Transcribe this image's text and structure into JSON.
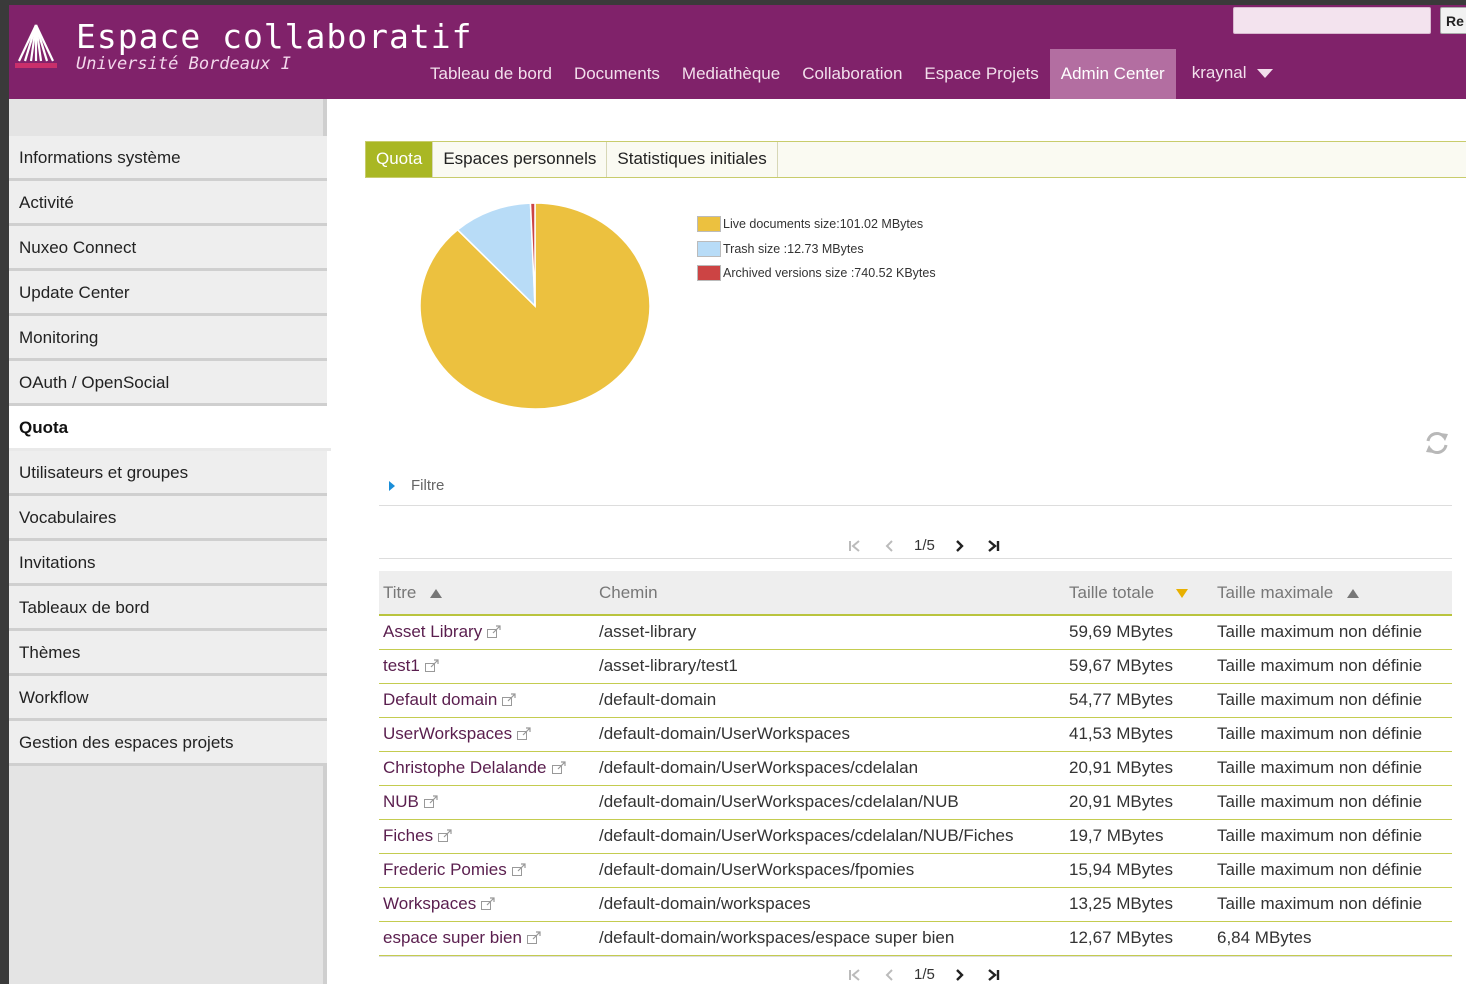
{
  "header": {
    "title": "Espace collaboratif",
    "subtitle": "Université Bordeaux I",
    "search_button": "Re",
    "search_value": "",
    "brand_color": "#80226a",
    "nav": [
      {
        "label": "Tableau de bord",
        "active": false
      },
      {
        "label": "Documents",
        "active": false
      },
      {
        "label": "Mediathèque",
        "active": false
      },
      {
        "label": "Collaboration",
        "active": false
      },
      {
        "label": "Espace Projets",
        "active": false
      },
      {
        "label": "Admin Center",
        "active": true
      }
    ],
    "user": "kraynal"
  },
  "sidebar": {
    "items": [
      {
        "label": "Informations système",
        "active": false
      },
      {
        "label": "Activité",
        "active": false
      },
      {
        "label": "Nuxeo Connect",
        "active": false
      },
      {
        "label": "Update Center",
        "active": false
      },
      {
        "label": "Monitoring",
        "active": false
      },
      {
        "label": "OAuth / OpenSocial",
        "active": false
      },
      {
        "label": "Quota",
        "active": true
      },
      {
        "label": "Utilisateurs et groupes",
        "active": false
      },
      {
        "label": "Vocabulaires",
        "active": false
      },
      {
        "label": "Invitations",
        "active": false
      },
      {
        "label": "Tableaux de bord",
        "active": false
      },
      {
        "label": "Thèmes",
        "active": false
      },
      {
        "label": "Workflow",
        "active": false
      },
      {
        "label": "Gestion des espaces projets",
        "active": false
      }
    ]
  },
  "tabs": [
    {
      "label": "Quota",
      "active": true
    },
    {
      "label": "Espaces personnels",
      "active": false
    },
    {
      "label": "Statistiques initiales",
      "active": false
    }
  ],
  "chart_data": {
    "type": "pie",
    "categories": [
      "Live documents size",
      "Trash size",
      "Archived versions size"
    ],
    "values": [
      101.02,
      12.73,
      0.72
    ],
    "colors": [
      "#ecc13f",
      "#b8dcf7",
      "#cc4444"
    ],
    "legend": [
      "Live documents size:101.02 MBytes",
      "Trash size :12.73 MBytes",
      "Archived versions size :740.52 KBytes"
    ],
    "legend_position": "right"
  },
  "filter_label": "Filtre",
  "pager": {
    "page": "1/5"
  },
  "table": {
    "headers": [
      "Titre",
      "Chemin",
      "Taille totale",
      "Taille maximale"
    ],
    "rows": [
      [
        "Asset Library",
        "/asset-library",
        "59,69 MBytes",
        "Taille maximum non définie"
      ],
      [
        "test1",
        "/asset-library/test1",
        "59,67 MBytes",
        "Taille maximum non définie"
      ],
      [
        "Default domain",
        "/default-domain",
        "54,77 MBytes",
        "Taille maximum non définie"
      ],
      [
        "UserWorkspaces",
        "/default-domain/UserWorkspaces",
        "41,53 MBytes",
        "Taille maximum non définie"
      ],
      [
        "Christophe Delalande",
        "/default-domain/UserWorkspaces/cdelalan",
        "20,91 MBytes",
        "Taille maximum non définie"
      ],
      [
        "NUB",
        "/default-domain/UserWorkspaces/cdelalan/NUB",
        "20,91 MBytes",
        "Taille maximum non définie"
      ],
      [
        "Fiches",
        "/default-domain/UserWorkspaces/cdelalan/NUB/Fiches",
        "19,7 MBytes",
        "Taille maximum non définie"
      ],
      [
        "Frederic Pomies",
        "/default-domain/UserWorkspaces/fpomies",
        "15,94 MBytes",
        "Taille maximum non définie"
      ],
      [
        "Workspaces",
        "/default-domain/workspaces",
        "13,25 MBytes",
        "Taille maximum non définie"
      ],
      [
        "espace super bien",
        "/default-domain/workspaces/espace super bien",
        "12,67 MBytes",
        "6,84 MBytes"
      ]
    ]
  },
  "icons": {
    "logo": "university-logo",
    "refresh": "refresh-icon",
    "external_link": "external-link-icon",
    "sort_asc": "sort-ascending-icon",
    "sort_desc": "sort-descending-icon"
  }
}
